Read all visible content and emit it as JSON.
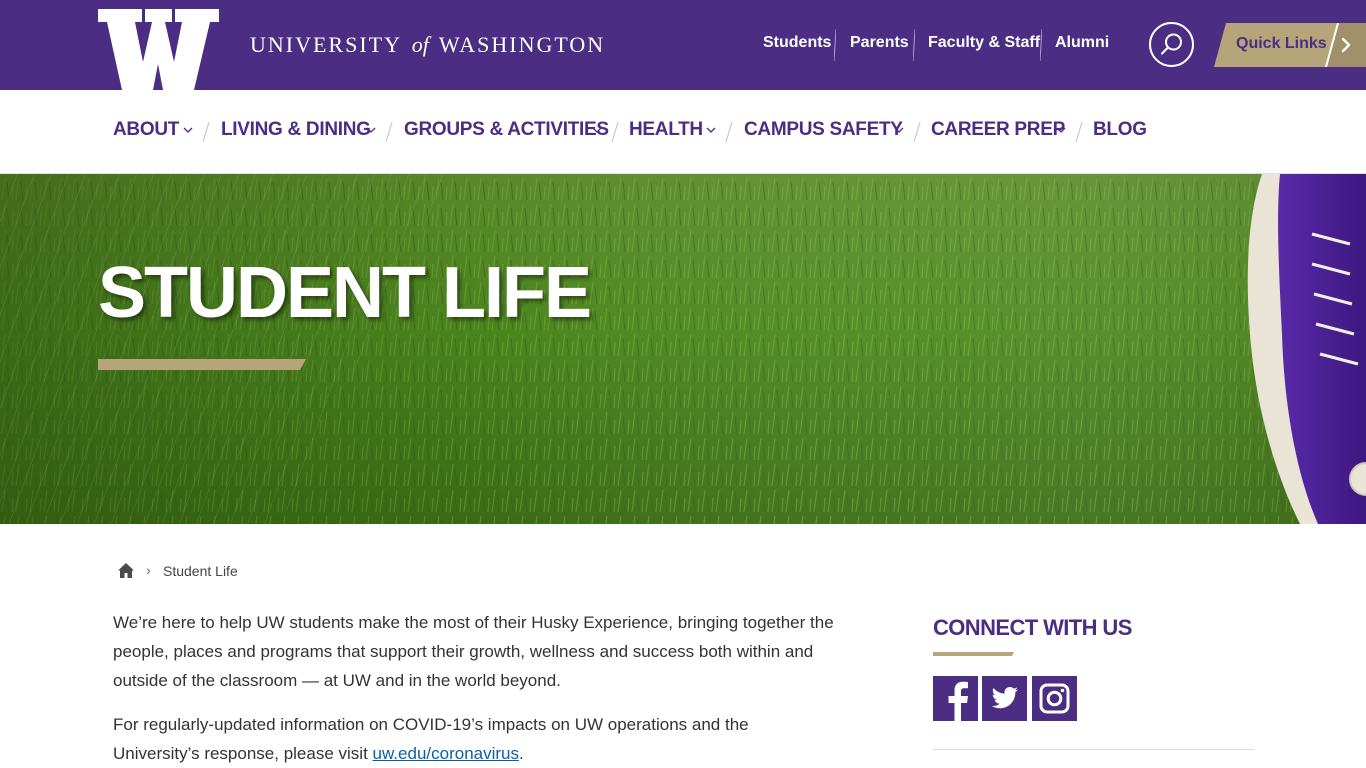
{
  "header": {
    "wordmark_left": "UNIVERSITY",
    "wordmark_of": "of",
    "wordmark_right": "WASHINGTON",
    "audience_links": [
      "Students",
      "Parents",
      "Faculty & Staff",
      "Alumni"
    ],
    "quick_links_label": "Quick Links",
    "search_icon": "search-icon",
    "quick_links_icon": "chevron-right-icon"
  },
  "nav": {
    "items": [
      {
        "label": "ABOUT",
        "has_dropdown": true
      },
      {
        "label": "LIVING & DINING",
        "has_dropdown": true
      },
      {
        "label": "GROUPS & ACTIVITIES",
        "has_dropdown": true
      },
      {
        "label": "HEALTH",
        "has_dropdown": true
      },
      {
        "label": "CAMPUS SAFETY",
        "has_dropdown": true
      },
      {
        "label": "CAREER PREP",
        "has_dropdown": true
      },
      {
        "label": "BLOG",
        "has_dropdown": false
      }
    ]
  },
  "hero": {
    "title": "STUDENT LIFE"
  },
  "breadcrumb": {
    "home_icon": "home-icon",
    "separator": "›",
    "current": "Student Life"
  },
  "main": {
    "paragraph1": "We’re here to help UW students make the most of their Husky Experience, bringing together the people, places and programs that support their growth, wellness and success both within and outside of the classroom — at UW and in the world beyond.",
    "paragraph2_before": "For regularly-updated information on COVID-19’s impacts on UW operations and the University’s response, please visit ",
    "paragraph2_link": "uw.edu/coronavirus",
    "paragraph2_after": "."
  },
  "sidebar": {
    "connect_title": "CONNECT WITH US",
    "social": [
      {
        "name": "facebook",
        "icon": "facebook-icon"
      },
      {
        "name": "twitter",
        "icon": "twitter-icon"
      },
      {
        "name": "instagram",
        "icon": "instagram-icon"
      }
    ]
  },
  "colors": {
    "purple": "#4b2e83",
    "gold": "#b7a57a",
    "link": "#0a5fa8",
    "grass": "#4f8a1e"
  }
}
